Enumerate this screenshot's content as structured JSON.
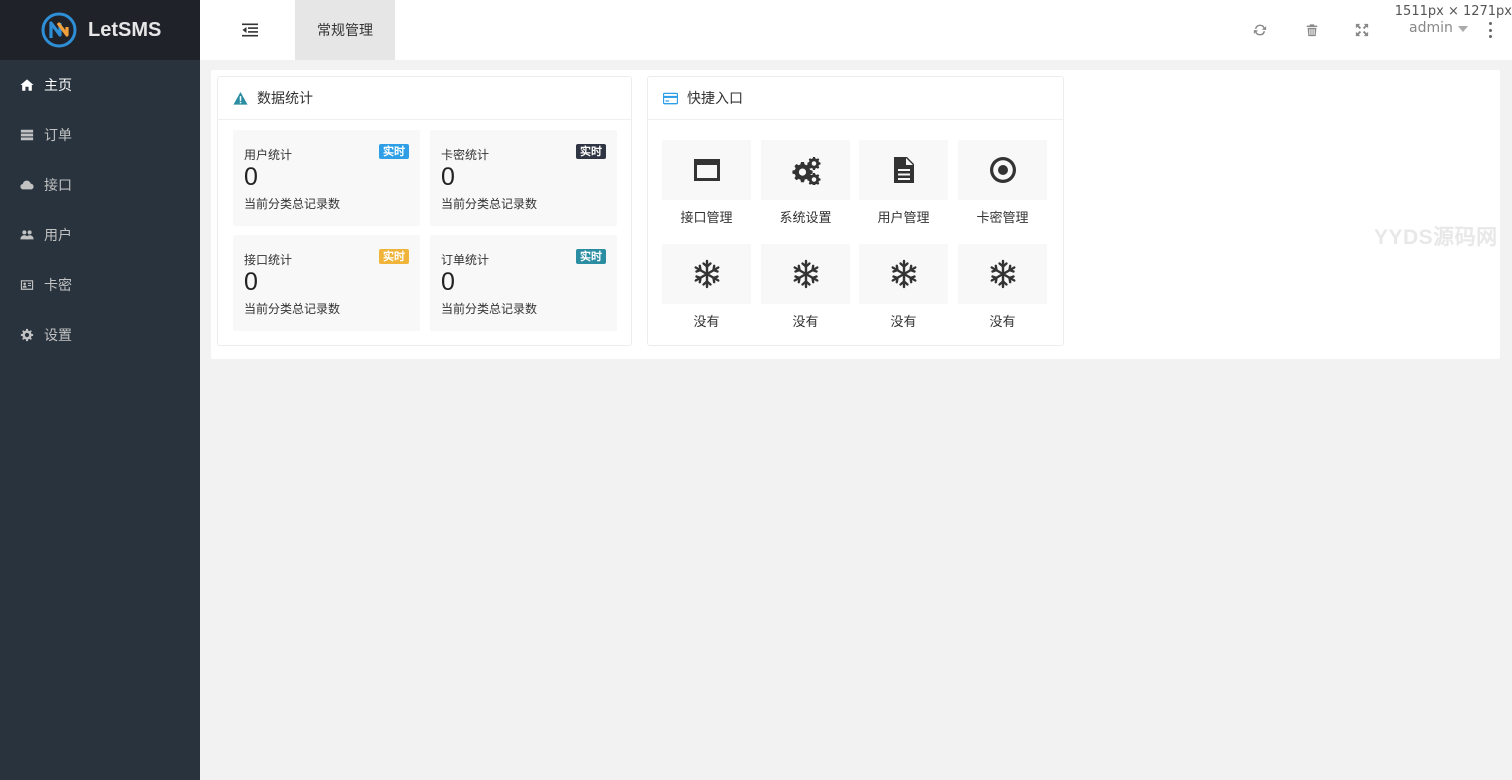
{
  "brand": {
    "name": "LetSMS"
  },
  "sidebar": {
    "items": [
      {
        "label": "主页",
        "icon": "home-icon",
        "active": true
      },
      {
        "label": "订单",
        "icon": "server-icon"
      },
      {
        "label": "接口",
        "icon": "cloud-icon"
      },
      {
        "label": "用户",
        "icon": "users-icon"
      },
      {
        "label": "卡密",
        "icon": "id-card-icon"
      },
      {
        "label": "设置",
        "icon": "gear-icon"
      }
    ]
  },
  "header": {
    "tab_label": "常规管理",
    "size_readout": "1511px × 1271px",
    "user": "admin"
  },
  "stats_card": {
    "title": "数据统计",
    "items": [
      {
        "title": "用户统计",
        "badge": "实时",
        "badge_color": "#2e9fe6",
        "value": "0",
        "desc": "当前分类总记录数"
      },
      {
        "title": "卡密统计",
        "badge": "实时",
        "badge_color": "#2f3542",
        "value": "0",
        "desc": "当前分类总记录数"
      },
      {
        "title": "接口统计",
        "badge": "实时",
        "badge_color": "#f0b43b",
        "value": "0",
        "desc": "当前分类总记录数"
      },
      {
        "title": "订单统计",
        "badge": "实时",
        "badge_color": "#2b8da2",
        "value": "0",
        "desc": "当前分类总记录数"
      }
    ]
  },
  "shortcuts_card": {
    "title": "快捷入口",
    "items": [
      {
        "label": "接口管理",
        "icon": "window-icon"
      },
      {
        "label": "系统设置",
        "icon": "cogs-icon"
      },
      {
        "label": "用户管理",
        "icon": "file-icon"
      },
      {
        "label": "卡密管理",
        "icon": "target-icon"
      },
      {
        "label": "没有",
        "icon": "snowflake-icon"
      },
      {
        "label": "没有",
        "icon": "snowflake-icon"
      },
      {
        "label": "没有",
        "icon": "snowflake-icon"
      },
      {
        "label": "没有",
        "icon": "snowflake-icon"
      }
    ]
  },
  "watermark": "YYDS源码网",
  "colors": {
    "sidebar": "#28333e",
    "logo_bg": "#20222a",
    "accent": "#2b8da2"
  }
}
